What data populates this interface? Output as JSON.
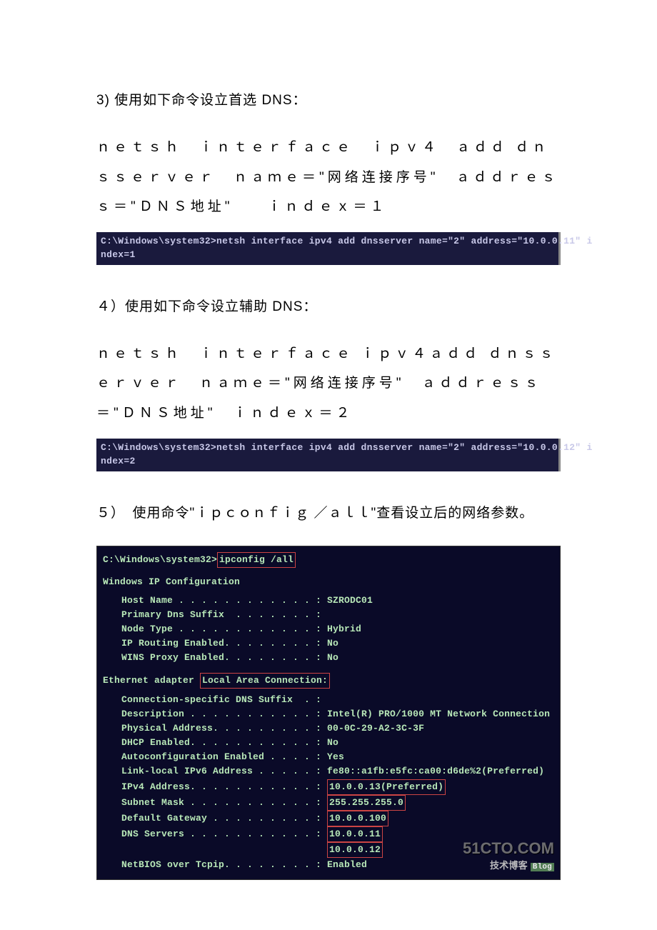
{
  "step3": {
    "title": "3)  使用如下命令设立首选 DNS：",
    "cmd": "ｎｅｔｓｈ　ｉｎｔｅｒｆａｃｅ　ｉｐｖ４　ａｄｄ ｄｎｓｓｅｒｖｅｒ　ｎａｍｅ＝\"网络连接序号\"　ａｄｄｒｅｓｓ＝\"ＤＮＳ地址\"　　ｉｎｄｅｘ＝１",
    "terminal": "C:\\Windows\\system32>netsh interface ipv4 add dnsserver name=\"2\" address=\"10.0.0.11\" i\nndex=1"
  },
  "step4": {
    "title": "４）使用如下命令设立辅助 DNS：",
    "cmd": "ｎｅｔｓｈ　ｉｎｔｅｒｆａｃｅ ｉｐｖ４ａｄｄ ｄｎｓｓｅｒｖｅｒ　ｎａｍｅ＝\"网络连接序号\"　ａｄｄｒｅｓｓ＝\"ＤＮＳ地址\"　ｉｎｄｅｘ＝２",
    "terminal": "C:\\Windows\\system32>netsh interface ipv4 add dnsserver name=\"2\" address=\"10.0.0.12\" i\nndex=2"
  },
  "step5": {
    "title": "５）　使用命令\"ｉｐｃｏｎｆｉｇ ／ａｌｌ\"查看设立后的网络参数。"
  },
  "ipconfig": {
    "prompt_prefix": "C:\\Windows\\system32>",
    "cmd_highlight": "ipconfig /all",
    "header1": "Windows IP Configuration",
    "rows1": [
      {
        "k": "Host Name . . . . . . . . . . . . : ",
        "v": "SZRODC01"
      },
      {
        "k": "Primary Dns Suffix  . . . . . . . : ",
        "v": ""
      },
      {
        "k": "Node Type . . . . . . . . . . . . : ",
        "v": "Hybrid"
      },
      {
        "k": "IP Routing Enabled. . . . . . . . : ",
        "v": "No"
      },
      {
        "k": "WINS Proxy Enabled. . . . . . . . : ",
        "v": "No"
      }
    ],
    "header2_prefix": "Ethernet adapter ",
    "header2_highlight": "Local Area Connection:",
    "rows2": [
      {
        "k": "Connection-specific DNS Suffix  . : ",
        "v": ""
      },
      {
        "k": "Description . . . . . . . . . . . : ",
        "v": "Intel(R) PRO/1000 MT Network Connection"
      },
      {
        "k": "Physical Address. . . . . . . . . : ",
        "v": "00-0C-29-A2-3C-3F"
      },
      {
        "k": "DHCP Enabled. . . . . . . . . . . : ",
        "v": "No"
      },
      {
        "k": "Autoconfiguration Enabled . . . . : ",
        "v": "Yes"
      },
      {
        "k": "Link-local IPv6 Address . . . . . : ",
        "v": "fe80::a1fb:e5fc:ca00:d6de%2(Preferred)"
      }
    ],
    "rows2_boxed": [
      {
        "k": "IPv4 Address. . . . . . . . . . . : ",
        "v": "10.0.0.13(Preferred)"
      },
      {
        "k": "Subnet Mask . . . . . . . . . . . : ",
        "v": "255.255.255.0"
      },
      {
        "k": "Default Gateway . . . . . . . . . : ",
        "v": "10.0.0.100"
      },
      {
        "k": "DNS Servers . . . . . . . . . . . : ",
        "v": "10.0.0.11"
      },
      {
        "k": "                                    ",
        "v": "10.0.0.12"
      }
    ],
    "rows2_tail": [
      {
        "k": "NetBIOS over Tcpip. . . . . . . . : ",
        "v": "Enabled"
      }
    ]
  },
  "watermark": {
    "line1": "51CTO.COM",
    "line2": "技术博客",
    "blog": "Blog"
  }
}
